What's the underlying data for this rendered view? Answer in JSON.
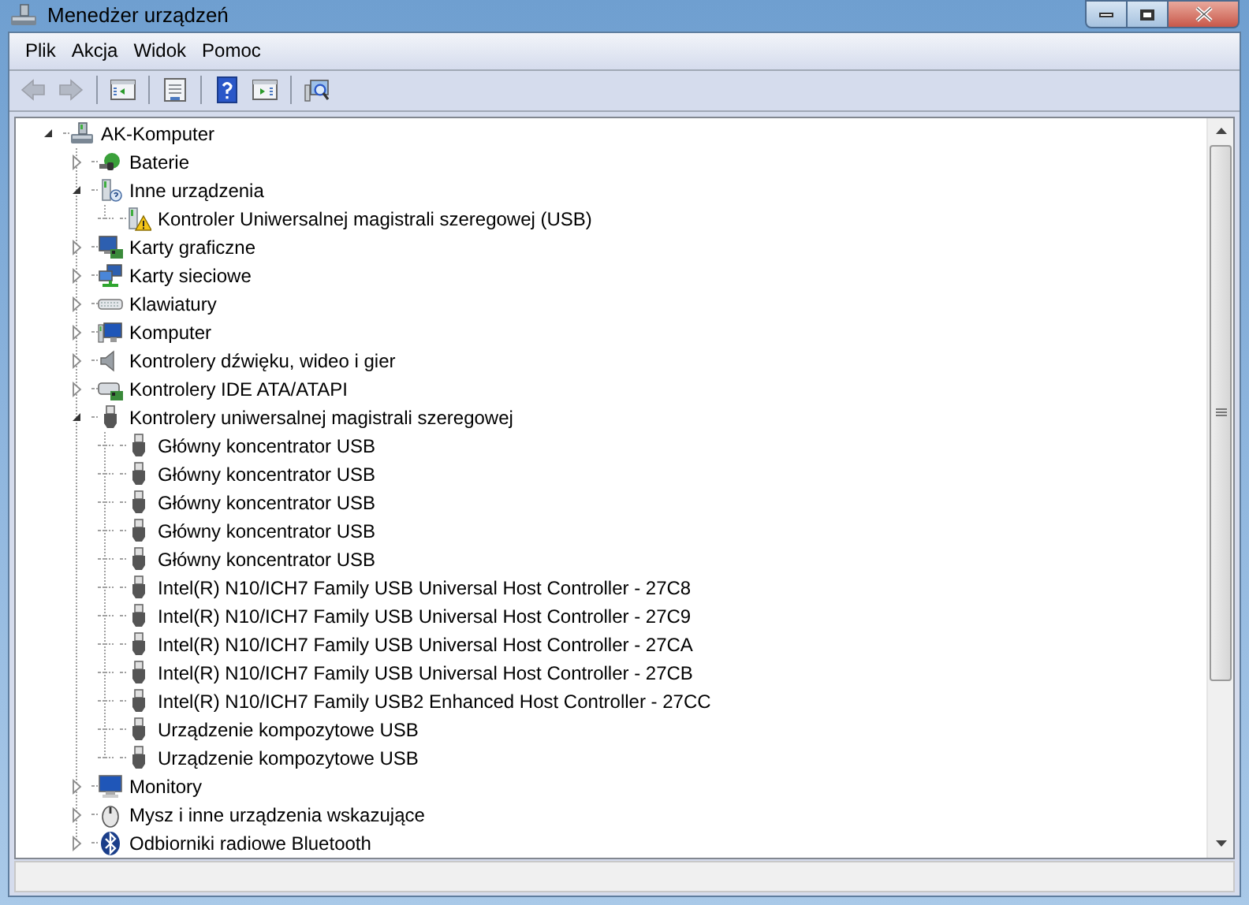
{
  "window": {
    "title": "Menedżer urządzeń"
  },
  "menu": [
    "Plik",
    "Akcja",
    "Widok",
    "Pomoc"
  ],
  "toolbar": [
    {
      "kind": "back",
      "disabled": true
    },
    {
      "kind": "forward",
      "disabled": true
    },
    {
      "kind": "separator"
    },
    {
      "kind": "console-tree",
      "disabled": false
    },
    {
      "kind": "separator"
    },
    {
      "kind": "properties",
      "disabled": false
    },
    {
      "kind": "separator"
    },
    {
      "kind": "help",
      "disabled": false
    },
    {
      "kind": "action-pane",
      "disabled": false
    },
    {
      "kind": "separator"
    },
    {
      "kind": "scan",
      "disabled": false
    }
  ],
  "tree": [
    {
      "label": "AK-Komputer",
      "kind": "computer",
      "expanded": true,
      "children": [
        {
          "label": "Baterie",
          "kind": "battery",
          "expanded": false
        },
        {
          "label": "Inne urządzenia",
          "kind": "unknown",
          "expanded": true,
          "children": [
            {
              "label": "Kontroler Uniwersalnej magistrali szeregowej (USB)",
              "kind": "warning"
            }
          ]
        },
        {
          "label": "Karty graficzne",
          "kind": "display",
          "expanded": false
        },
        {
          "label": "Karty sieciowe",
          "kind": "network",
          "expanded": false
        },
        {
          "label": "Klawiatury",
          "kind": "keyboard",
          "expanded": false
        },
        {
          "label": "Komputer",
          "kind": "pc",
          "expanded": false
        },
        {
          "label": "Kontrolery dźwięku, wideo i gier",
          "kind": "speaker",
          "expanded": false
        },
        {
          "label": "Kontrolery IDE ATA/ATAPI",
          "kind": "ide",
          "expanded": false
        },
        {
          "label": "Kontrolery uniwersalnej magistrali szeregowej",
          "kind": "usb",
          "expanded": true,
          "children": [
            {
              "label": "Główny koncentrator USB",
              "kind": "usb"
            },
            {
              "label": "Główny koncentrator USB",
              "kind": "usb"
            },
            {
              "label": "Główny koncentrator USB",
              "kind": "usb"
            },
            {
              "label": "Główny koncentrator USB",
              "kind": "usb"
            },
            {
              "label": "Główny koncentrator USB",
              "kind": "usb"
            },
            {
              "label": "Intel(R) N10/ICH7 Family USB Universal Host Controller - 27C8",
              "kind": "usb"
            },
            {
              "label": "Intel(R) N10/ICH7 Family USB Universal Host Controller - 27C9",
              "kind": "usb"
            },
            {
              "label": "Intel(R) N10/ICH7 Family USB Universal Host Controller - 27CA",
              "kind": "usb"
            },
            {
              "label": "Intel(R) N10/ICH7 Family USB Universal Host Controller - 27CB",
              "kind": "usb"
            },
            {
              "label": "Intel(R) N10/ICH7 Family USB2 Enhanced Host Controller - 27CC",
              "kind": "usb"
            },
            {
              "label": "Urządzenie kompozytowe USB",
              "kind": "usb"
            },
            {
              "label": "Urządzenie kompozytowe USB",
              "kind": "usb"
            }
          ]
        },
        {
          "label": "Monitory",
          "kind": "monitor",
          "expanded": false
        },
        {
          "label": "Mysz i inne urządzenia wskazujące",
          "kind": "mouse",
          "expanded": false
        },
        {
          "label": "Odbiorniki radiowe Bluetooth",
          "kind": "bluetooth",
          "expanded": false
        }
      ]
    }
  ]
}
